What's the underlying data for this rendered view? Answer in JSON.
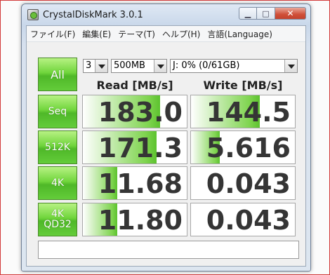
{
  "window": {
    "title": "CrystalDiskMark 3.0.1"
  },
  "menu": [
    "ファイル(F)",
    "編集(E)",
    "テーマ(T)",
    "ヘルプ(H)",
    "言語(Language)"
  ],
  "controls": {
    "all_label": "All",
    "count": "3",
    "size": "500MB",
    "drive": "J: 0% (0/61GB)"
  },
  "headers": {
    "read": "Read [MB/s]",
    "write": "Write [MB/s]"
  },
  "rows": [
    {
      "label": "Seq",
      "read": "183.0",
      "write": "144.5",
      "read_fill": 0.74,
      "write_fill": 0.66
    },
    {
      "label": "512K",
      "read": "171.3",
      "write": "5.616",
      "read_fill": 0.71,
      "write_fill": 0.28
    },
    {
      "label": "4K",
      "read": "11.68",
      "write": "0.043",
      "read_fill": 0.33,
      "write_fill": 0.0
    },
    {
      "label": "4K\nQD32",
      "read": "11.80",
      "write": "0.043",
      "read_fill": 0.33,
      "write_fill": 0.0
    }
  ],
  "colors": {
    "accent_green": "#63cc3a",
    "close_red": "#cf4f38"
  }
}
